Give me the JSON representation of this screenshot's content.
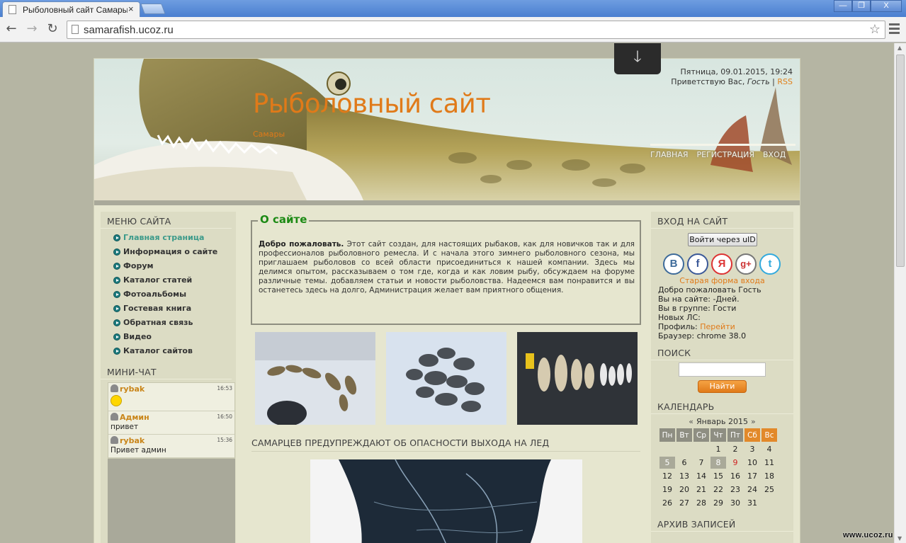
{
  "browser": {
    "tab_title": "Рыболовный сайт Самары - ",
    "tab_close": "×",
    "url": "samarafish.ucoz.ru",
    "window_buttons": [
      "—",
      "❐",
      "X"
    ]
  },
  "header": {
    "date_line": "Пятница, 09.01.2015, 19:24",
    "greeting_prefix": "Приветствую Вас, ",
    "greeting_user": "Гость",
    "separator": " | ",
    "rss": "RSS",
    "site_title": "Рыболовный сайт",
    "site_subtitle": "Самары",
    "nav": [
      "ГЛАВНАЯ",
      "РЕГИСТРАЦИЯ",
      "ВХОД"
    ]
  },
  "menu": {
    "title": "МЕНЮ САЙТА",
    "items": [
      "Главная страница",
      "Информация о сайте",
      "Форум",
      "Каталог статей",
      "Фотоальбомы",
      "Гостевая книга",
      "Обратная связь",
      "Видео",
      "Каталог сайтов"
    ]
  },
  "chat": {
    "title": "МИНИ-ЧАТ",
    "messages": [
      {
        "nick": "rybak",
        "time": "16:53",
        "text": ""
      },
      {
        "nick": "Админ",
        "time": "16:50",
        "text": "привет"
      },
      {
        "nick": "rybak",
        "time": "15:36",
        "text": "Привет админ"
      }
    ]
  },
  "about": {
    "legend": "О сайте",
    "lead": "Добро пожаловать.",
    "text": " Этот сайт создан,  для настоящих рыбаков, как для новичков так и для профессионалов рыболовного ремесла. И с начала этого зимнего рыболовного сезона, мы приглашаем рыболовов со всей области присоединиться к нашей компании. Здесь мы делимся опытом, рассказываем о том где, когда и как ловим рыбу, обсуждаем на форуме различные темы. добавляем статьи и новости рыболовства. Надеемся вам понравится и вы останетесь здесь на долго, Администрация желает вам приятного общения."
  },
  "news": {
    "title": "САМАРЦЕВ ПРЕДУПРЕЖДАЮТ ОБ ОПАСНОСТИ ВЫХОДА НА ЛЕД"
  },
  "login": {
    "title": "ВХОД НА САЙТ",
    "uid_button": "Войти через uID",
    "social": [
      "В",
      "f",
      "Я",
      "g+",
      "t"
    ],
    "old_form": "Старая форма входа",
    "welcome": "Добро пожаловать Гость",
    "online_label": "Вы на сайте: -Дней.",
    "group_label": "Вы в группе: Гости",
    "pm_label": "Новых ЛС:",
    "profile_label": "Профиль: ",
    "profile_link": "Перейти",
    "browser_label": "Браузер: chrome 38.0"
  },
  "search": {
    "title": "ПОИСК",
    "button": "Найти"
  },
  "calendar": {
    "title": "КАЛЕНДАРЬ",
    "prev": "«",
    "month": "Январь 2015",
    "next": "»",
    "days_of_week": [
      "Пн",
      "Вт",
      "Ср",
      "Чт",
      "Пт",
      "Сб",
      "Вс"
    ],
    "weeks": [
      [
        "",
        "",
        "",
        "1",
        "2",
        "3",
        "4"
      ],
      [
        "5",
        "6",
        "7",
        "8",
        "9",
        "10",
        "11"
      ],
      [
        "12",
        "13",
        "14",
        "15",
        "16",
        "17",
        "18"
      ],
      [
        "19",
        "20",
        "21",
        "22",
        "23",
        "24",
        "25"
      ],
      [
        "26",
        "27",
        "28",
        "29",
        "30",
        "31",
        ""
      ]
    ]
  },
  "archive": {
    "title": "АРХИВ ЗАПИСЕЙ"
  },
  "watermark": "www.ucoz.ru",
  "colors": {
    "accent_orange": "#e07a19",
    "legend_green": "#1c8a14",
    "page_bg": "#e6e6cf",
    "column_bg": "#dcdcc4"
  }
}
